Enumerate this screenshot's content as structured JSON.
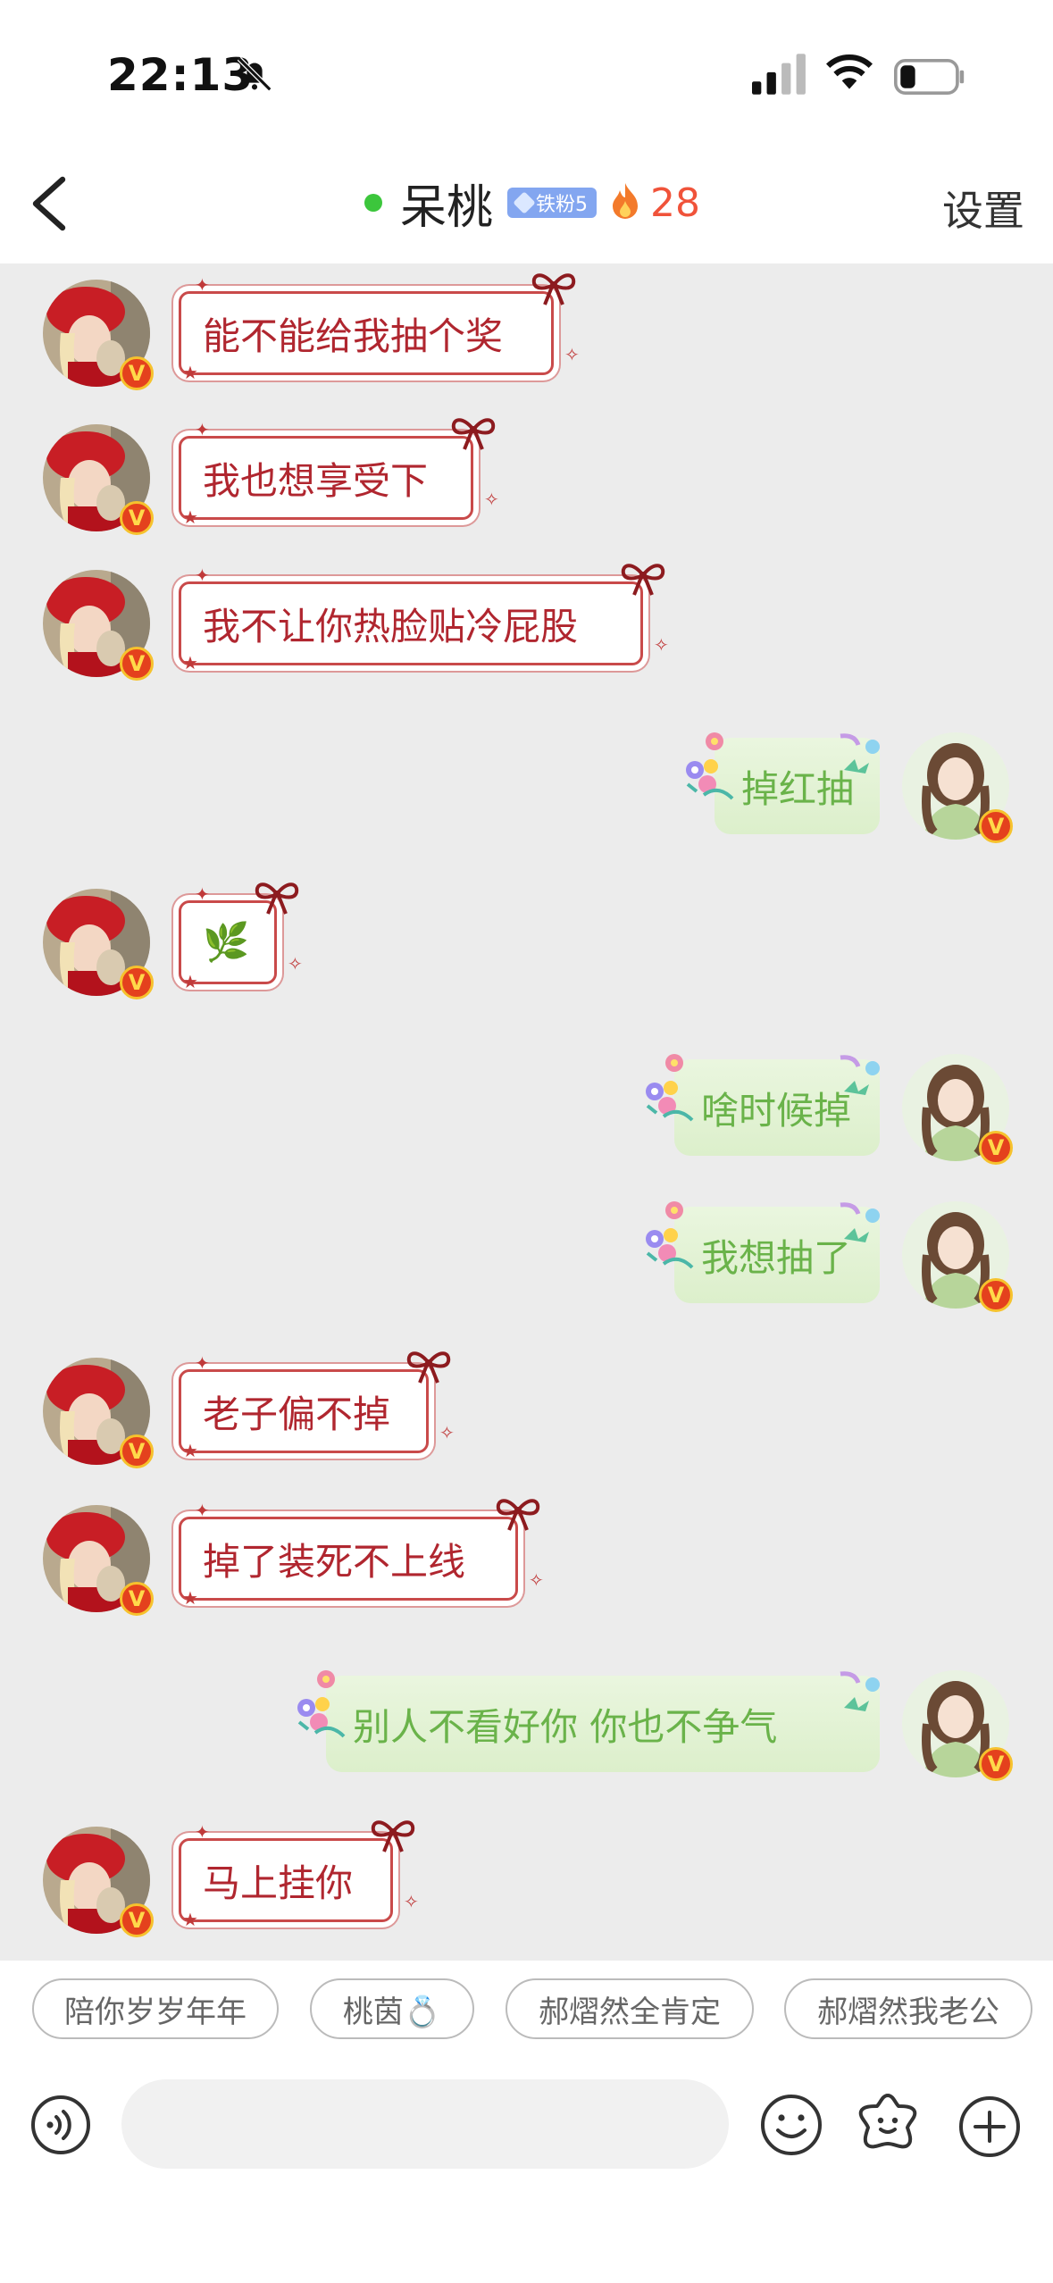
{
  "status_bar": {
    "time": "22:13",
    "icons": [
      "bell-slash-icon",
      "signal-icon",
      "wifi-icon",
      "battery-icon"
    ]
  },
  "header": {
    "back_icon": "chevron-left-icon",
    "title": "呆桃",
    "fan_badge": "铁粉5",
    "fire_count": "28",
    "settings": "设置",
    "colors": {
      "online": "#3cc63c",
      "fire": "#f0533a",
      "badge": "#83a6f0"
    }
  },
  "messages": [
    {
      "side": "left",
      "text": "能不能给我抽个奖"
    },
    {
      "side": "left",
      "text": "我也想享受下"
    },
    {
      "side": "left",
      "text": "我不让你热脸贴冷屁股"
    },
    {
      "side": "right",
      "text": "掉红抽"
    },
    {
      "side": "left",
      "text": "",
      "emoji": "🌿"
    },
    {
      "side": "right",
      "text": "啥时候掉"
    },
    {
      "side": "right",
      "text": "我想抽了"
    },
    {
      "side": "left",
      "text": "老子偏不掉"
    },
    {
      "side": "left",
      "text": "掉了装死不上线"
    },
    {
      "side": "right",
      "text": "别人不看好你 你也不争气"
    },
    {
      "side": "left",
      "text": "马上挂你"
    }
  ],
  "quick_replies": [
    "陪你岁岁年年",
    "桃茵💍",
    "郝熠然全肯定",
    "郝熠然我老公"
  ],
  "input_bar": {
    "placeholder": "",
    "icons": [
      "voice-icon",
      "emoji-face-icon",
      "sticker-flower-icon",
      "plus-icon"
    ]
  },
  "avatar_badge": "V"
}
